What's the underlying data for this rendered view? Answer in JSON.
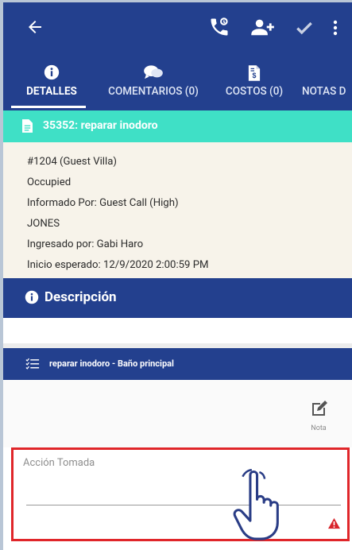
{
  "header": {
    "icons": [
      "arrow-left-icon",
      "phone-icon",
      "add-user-icon",
      "check-icon",
      "more-vert-icon"
    ]
  },
  "tabs": [
    {
      "label": "DETALLES",
      "icon": "info-icon",
      "active": true
    },
    {
      "label": "COMENTARIOS (0)",
      "icon": "chat-icon",
      "active": false
    },
    {
      "label": "COSTOS (0)",
      "icon": "invoice-icon",
      "active": false
    },
    {
      "label": "NOTAS D",
      "icon": "",
      "active": false
    }
  ],
  "work_order": {
    "title": "35352: reparar inodoro",
    "lines": [
      "#1204 (Guest Villa)",
      "Occupied",
      "Informado Por: Guest Call  (High)",
      "JONES",
      "Ingresado por: Gabi Haro",
      "Inicio esperado: 12/9/2020 2:00:59 PM"
    ]
  },
  "description": {
    "title": "Descripción"
  },
  "task": {
    "title": "reparar inodoro - Baño principal"
  },
  "note": {
    "label": "Nota"
  },
  "action_field": {
    "placeholder": "Acción Tomada",
    "value": ""
  },
  "colors": {
    "primary": "#23408e",
    "accent": "#3fe0c6",
    "highlight": "#e0262a",
    "info_bg": "#f7f3ea"
  }
}
